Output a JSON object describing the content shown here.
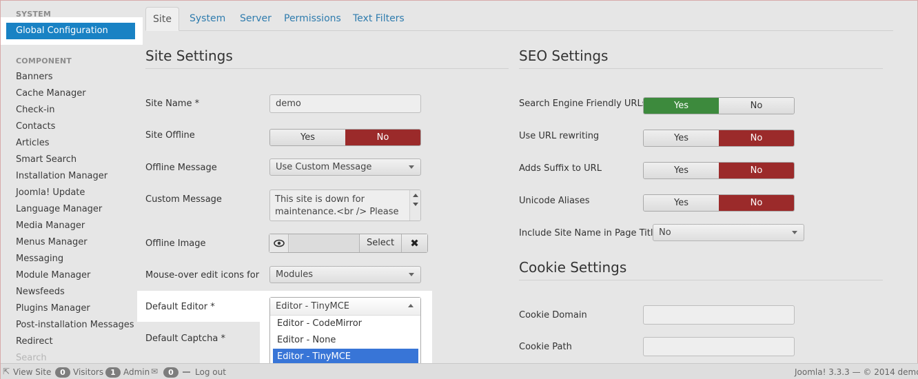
{
  "sidebar": {
    "system_heading": "SYSTEM",
    "global_configuration": "Global Configuration",
    "component_heading": "COMPONENT",
    "items": [
      "Banners",
      "Cache Manager",
      "Check-in",
      "Contacts",
      "Articles",
      "Smart Search",
      "Installation Manager",
      "Joomla! Update",
      "Language Manager",
      "Media Manager",
      "Menus Manager",
      "Messaging",
      "Module Manager",
      "Newsfeeds",
      "Plugins Manager",
      "Post-installation Messages",
      "Redirect"
    ],
    "faded_item": "Search"
  },
  "tabs": [
    "Site",
    "System",
    "Server",
    "Permissions",
    "Text Filters"
  ],
  "site_settings": {
    "title": "Site Settings",
    "site_name_label": "Site Name *",
    "site_name_value": "demo",
    "site_offline_label": "Site Offline",
    "offline_message_label": "Offline Message",
    "offline_message_value": "Use Custom Message",
    "custom_message_label": "Custom Message",
    "custom_message_line1": "This site is down for",
    "custom_message_line2": "maintenance.<br /> Please",
    "offline_image_label": "Offline Image",
    "select_label": "Select",
    "close_glyph": "✖",
    "mouseover_label": "Mouse-over edit icons for",
    "mouseover_value": "Modules",
    "default_editor_label": "Default Editor *",
    "default_editor_value": "Editor - TinyMCE",
    "editor_options": [
      "Editor - CodeMirror",
      "Editor - None",
      "Editor - TinyMCE"
    ],
    "default_captcha_label": "Default Captcha *"
  },
  "seo_settings": {
    "title": "SEO Settings",
    "sef_label": "Search Engine Friendly URLs",
    "rewrite_label": "Use URL rewriting",
    "suffix_label": "Adds Suffix to URL",
    "unicode_label": "Unicode Aliases",
    "sitename_label": "Include Site Name in Page Titles",
    "sitename_value": "No"
  },
  "cookie_settings": {
    "title": "Cookie Settings",
    "domain_label": "Cookie Domain",
    "path_label": "Cookie Path"
  },
  "toggle": {
    "yes": "Yes",
    "no": "No"
  },
  "statusbar": {
    "view_site": "View Site",
    "visitors_count": "0",
    "visitors_label": "Visitors",
    "admin_count": "1",
    "admin_label": "Admin",
    "messages_count": "0",
    "logout_label": "Log out",
    "version": "Joomla! 3.3.3  —  © 2014 demo"
  },
  "colors": {
    "primary_blue": "#1982c4",
    "toggle_red": "#9b2a2a",
    "toggle_green": "#3d8a3d",
    "selected_option": "#3875d7"
  }
}
